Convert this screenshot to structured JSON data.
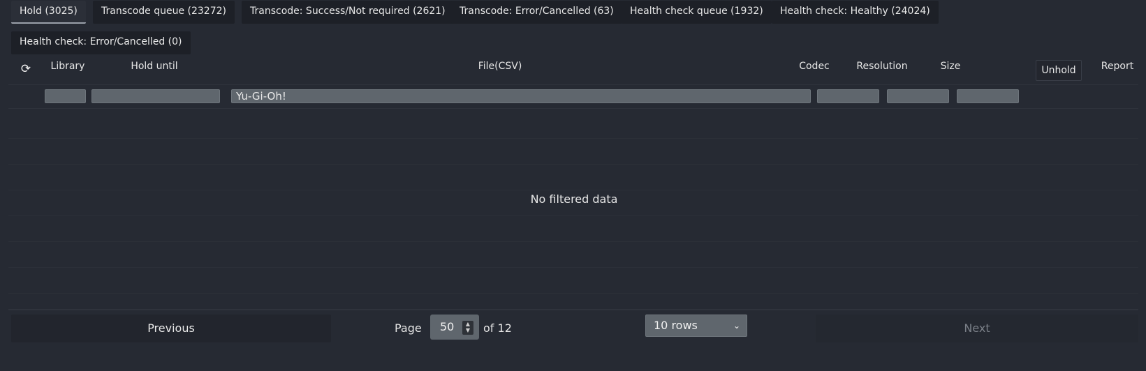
{
  "tabs": [
    {
      "label": "Hold (3025)",
      "active": true
    },
    {
      "label": "Transcode queue (23272)"
    },
    {
      "label": "Transcode: Success/Not required (2621)"
    },
    {
      "label": "Transcode: Error/Cancelled (63)"
    },
    {
      "label": "Health check queue (1932)"
    },
    {
      "label": "Health check: Healthy (24024)"
    },
    {
      "label": "Health check: Error/Cancelled (0)"
    }
  ],
  "table": {
    "refresh_icon": "refresh-icon",
    "columns": {
      "library": "Library",
      "hold_until": "Hold until",
      "file": "File(CSV)",
      "codec": "Codec",
      "resolution": "Resolution",
      "size": "Size",
      "unhold": "Unhold",
      "report": "Report"
    },
    "filters": {
      "library": "",
      "hold_until": "",
      "file": "Yu-Gi-Oh!",
      "codec": "",
      "resolution": "",
      "size": ""
    },
    "empty_message": "No filtered data"
  },
  "pagination": {
    "previous": "Previous",
    "page_label": "Page",
    "page_value": "50",
    "of_label": "of 12",
    "rows_selected": "10 rows",
    "next": "Next"
  },
  "colors": {
    "background": "#262a33",
    "input": "#5f666d",
    "tab": "#1d2027"
  }
}
